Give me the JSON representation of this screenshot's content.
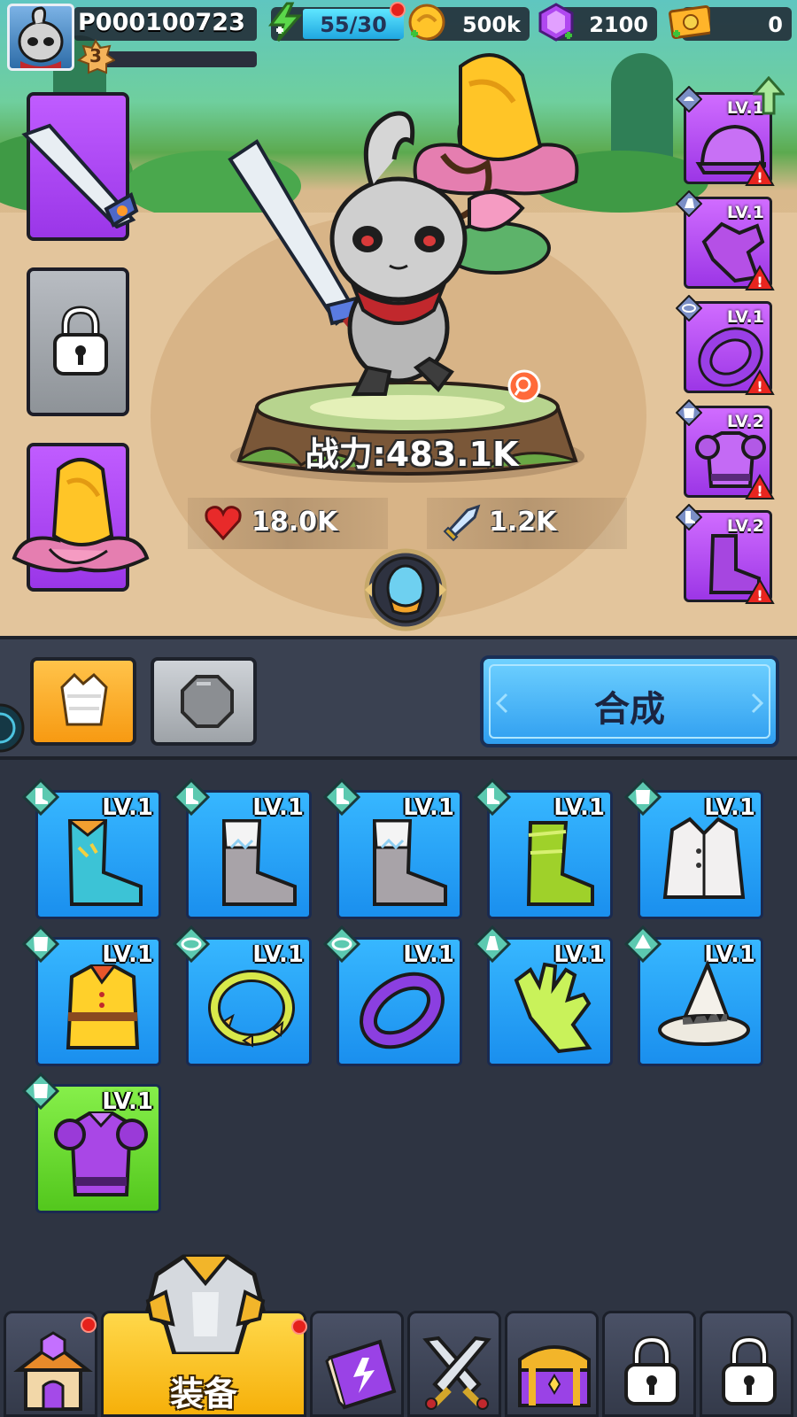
{
  "player": {
    "id": "P000100723",
    "level": "3"
  },
  "resources": {
    "energy": {
      "icon": "energy-bolt-icon",
      "value": "55/30"
    },
    "coins": {
      "icon": "gold-coin-icon",
      "value": "500k"
    },
    "gems": {
      "icon": "purple-gem-icon",
      "value": "2100"
    },
    "cash": {
      "icon": "cash-ticket-icon",
      "value": "0"
    }
  },
  "hero": {
    "power": "战力:483.1K",
    "hp": "18.0K",
    "attack": "1.2K"
  },
  "equipped": [
    {
      "slot": "helmet",
      "level": "LV.1",
      "icon": "helmet-icon"
    },
    {
      "slot": "gloves",
      "level": "LV.1",
      "icon": "gloves-icon"
    },
    {
      "slot": "ring",
      "level": "LV.1",
      "icon": "ring-icon"
    },
    {
      "slot": "armor",
      "level": "LV.2",
      "icon": "armor-icon"
    },
    {
      "slot": "boots",
      "level": "LV.2",
      "icon": "boots-icon"
    }
  ],
  "actions": {
    "synthesize": "合成"
  },
  "inventory": [
    {
      "name": "teal-boots",
      "level": "LV.1",
      "color": "#3cc3d6"
    },
    {
      "name": "grey-boots",
      "level": "LV.1",
      "color": "#a8a3a8"
    },
    {
      "name": "grey-boots",
      "level": "LV.1",
      "color": "#a8a3a8"
    },
    {
      "name": "green-boots",
      "level": "LV.1",
      "color": "#9fd12a"
    },
    {
      "name": "white-vest",
      "level": "LV.1",
      "color": "#f2f0f0"
    },
    {
      "name": "yellow-coat",
      "level": "LV.1",
      "color": "#ffd02a"
    },
    {
      "name": "laurel-ring",
      "level": "LV.1",
      "color": "#d8e84a"
    },
    {
      "name": "purple-bracelet",
      "level": "LV.1",
      "color": "#8b3fe0"
    },
    {
      "name": "green-glove",
      "level": "LV.1",
      "color": "#c9f25a"
    },
    {
      "name": "wizard-hat",
      "level": "LV.1",
      "color": "#f4f1ea"
    },
    {
      "name": "purple-armor",
      "level": "LV.1",
      "color": "#a947e6"
    }
  ],
  "nav": {
    "active_label": "装备"
  }
}
